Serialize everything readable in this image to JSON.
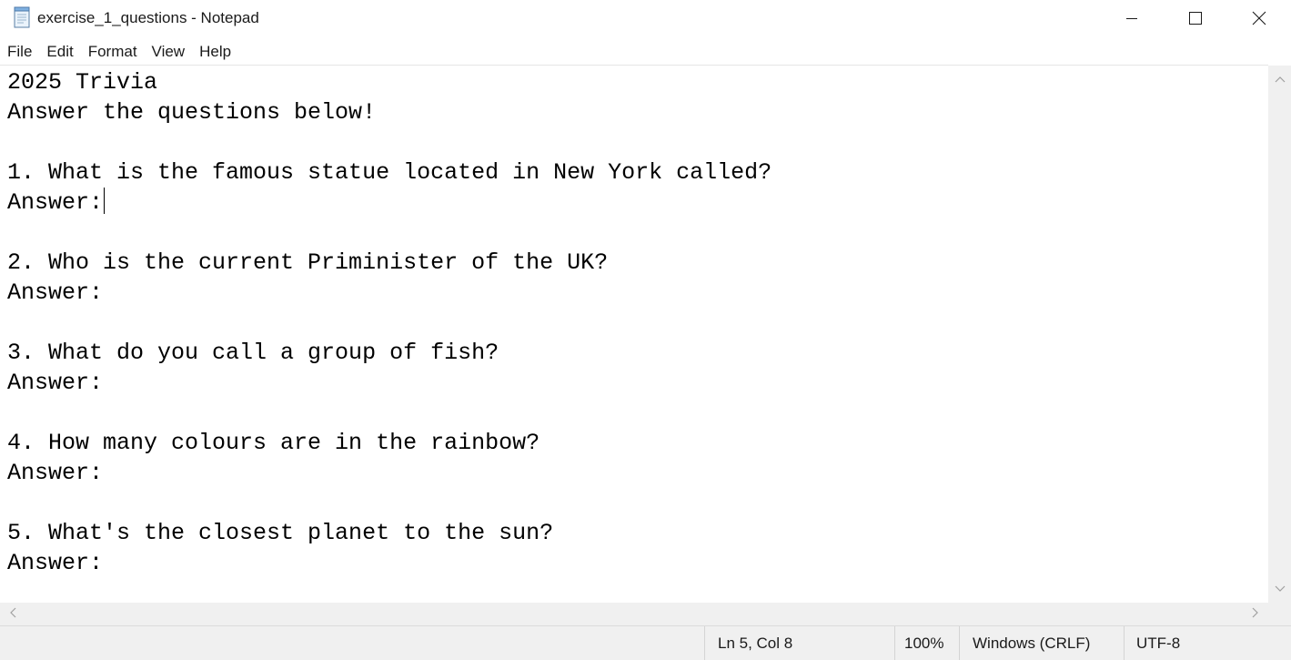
{
  "window": {
    "title": "exercise_1_questions - Notepad",
    "app_icon": "notepad-icon",
    "controls": [
      "minimize-icon",
      "maximize-icon",
      "close-icon"
    ]
  },
  "menu": {
    "items": [
      {
        "label": "File"
      },
      {
        "label": "Edit"
      },
      {
        "label": "Format"
      },
      {
        "label": "View"
      },
      {
        "label": "Help"
      }
    ]
  },
  "editor": {
    "lines": [
      "2025 Trivia",
      "Answer the questions below!",
      "",
      "1. What is the famous statue located in New York called?",
      "Answer:",
      "",
      "2. Who is the current Priminister of the UK?",
      "Answer:",
      "",
      "3. What do you call a group of fish?",
      "Answer:",
      "",
      "4. How many colours are in the rainbow?",
      "Answer:",
      "",
      "5. What's the closest planet to the sun?",
      "Answer:"
    ],
    "caret_line": 5,
    "caret_col": 8
  },
  "statusbar": {
    "position": "Ln 5, Col 8",
    "zoom": "100%",
    "line_ending": "Windows (CRLF)",
    "encoding": "UTF-8"
  }
}
